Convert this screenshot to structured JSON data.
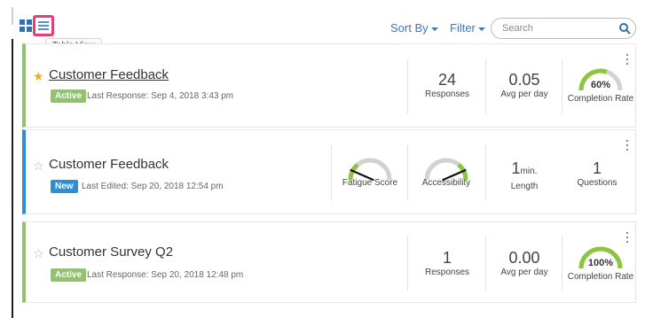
{
  "toolbar": {
    "grid_view_icon": "grid-view-icon",
    "table_view_icon": "list-view-icon",
    "tooltip": "Table View",
    "sort_label": "Sort By",
    "filter_label": "Filter",
    "search_placeholder": "Search",
    "accent_color": "#3a78c3"
  },
  "cards": [
    {
      "starred": true,
      "title": "Customer Feedback",
      "status": "Active",
      "status_color": "#8fc46b",
      "meta": "Last Response: Sep 4, 2018 3:43 pm",
      "responses": "24",
      "responses_label": "Responses",
      "avg": "0.05",
      "avg_label": "Avg per day",
      "completion_pct": "60%",
      "completion_value": 0.6,
      "completion_label": "Completion Rate"
    },
    {
      "starred": false,
      "title": "Customer Feedback",
      "status": "New",
      "status_color": "#2c8fd6",
      "meta": "Last Edited: Sep 20, 2018 12:54 pm",
      "fatigue_label": "Fatigue Score",
      "fatigue_value": 0.15,
      "accessibility_label": "Accessibility",
      "accessibility_value": 0.85,
      "length_value": "1",
      "length_unit": "min.",
      "length_label": "Length",
      "questions": "1",
      "questions_label": "Questions"
    },
    {
      "starred": false,
      "title": "Customer Survey Q2",
      "status": "Active",
      "status_color": "#8fc46b",
      "meta": "Last Response: Sep 20, 2018 12:48 pm",
      "responses": "1",
      "responses_label": "Responses",
      "avg": "0.00",
      "avg_label": "Avg per day",
      "completion_pct": "100%",
      "completion_value": 1.0,
      "completion_label": "Completion Rate"
    }
  ]
}
